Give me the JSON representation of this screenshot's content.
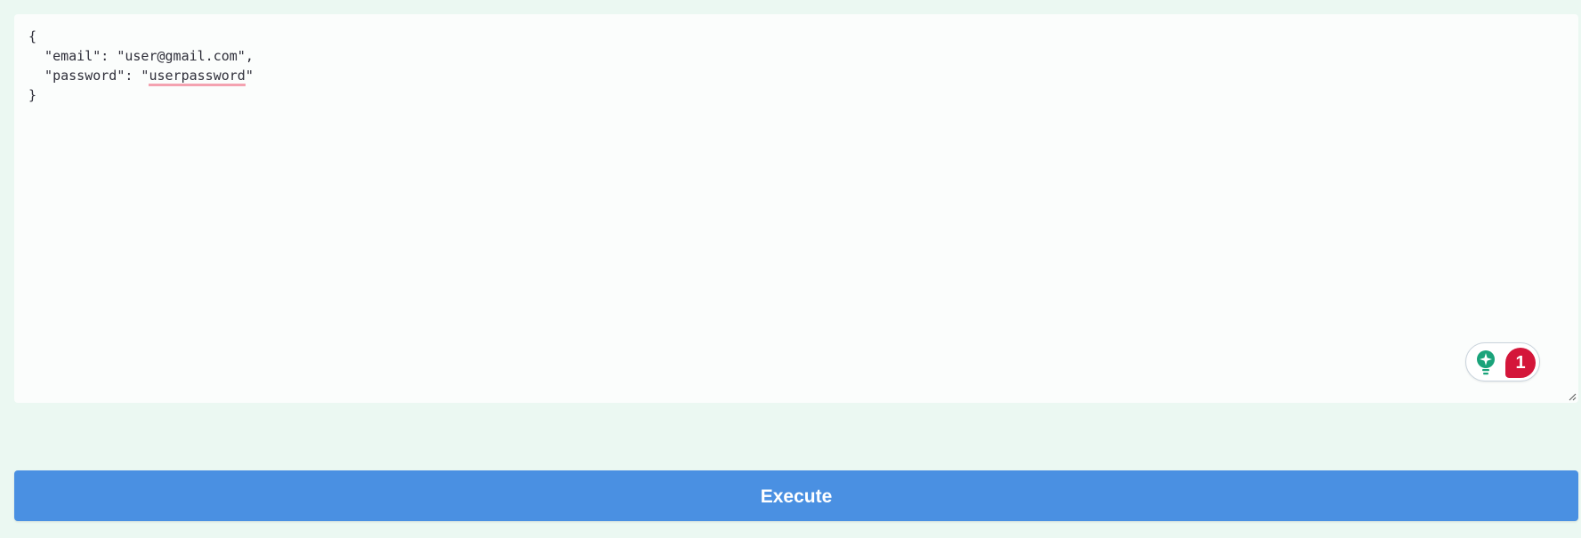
{
  "request_body": {
    "line1": "{",
    "line2_prefix": "  \"email\": \"user@gmail.com\",",
    "line3_prefix": "  \"password\": \"",
    "line3_misspelled": "userpassword",
    "line3_suffix": "\"",
    "line4": "}"
  },
  "assistant": {
    "badge_count": "1",
    "icon": "lightbulb-sparkle-icon",
    "accent_color": "#1aa37a",
    "badge_color": "#d4163a"
  },
  "actions": {
    "execute_label": "Execute",
    "execute_color": "#4a90e2"
  }
}
